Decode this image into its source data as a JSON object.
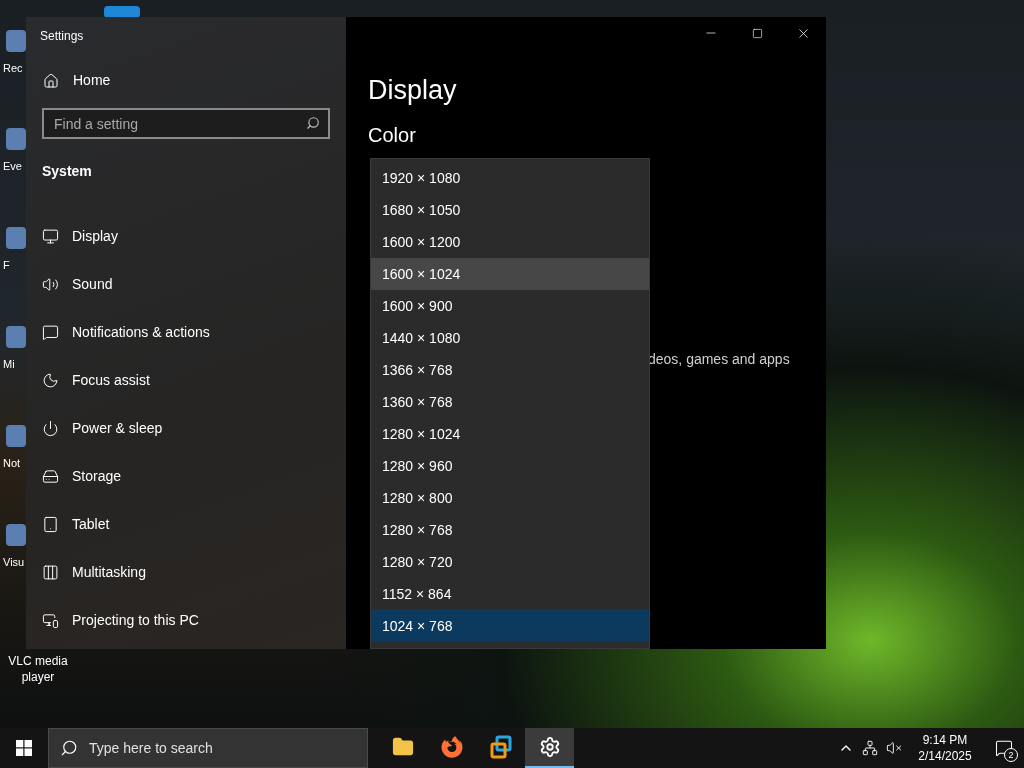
{
  "desktop": {
    "icons": [
      {
        "label": "Rec"
      },
      {
        "label": "Eve"
      },
      {
        "label": "F"
      },
      {
        "label": "Mi"
      },
      {
        "label": "Not"
      },
      {
        "label": "Visu"
      },
      {
        "label": "VLC media player"
      }
    ]
  },
  "window": {
    "title": "Settings",
    "sidebar": {
      "home": "Home",
      "search": {
        "placeholder": "Find a setting"
      },
      "section": "System",
      "items": [
        {
          "label": "Display",
          "kind": "display"
        },
        {
          "label": "Sound",
          "kind": "sound"
        },
        {
          "label": "Notifications & actions",
          "kind": "notifications"
        },
        {
          "label": "Focus assist",
          "kind": "focus"
        },
        {
          "label": "Power & sleep",
          "kind": "power"
        },
        {
          "label": "Storage",
          "kind": "storage"
        },
        {
          "label": "Tablet",
          "kind": "tablet"
        },
        {
          "label": "Multitasking",
          "kind": "multitasking"
        },
        {
          "label": "Projecting to this PC",
          "kind": "projecting"
        }
      ]
    },
    "content": {
      "heading": "Display",
      "section": "Color",
      "partial_texts": [
        "deos, games and apps"
      ],
      "dropdown": {
        "options": [
          {
            "label": "1920 × 1080",
            "selected": false,
            "hovered": false
          },
          {
            "label": "1680 × 1050",
            "selected": false,
            "hovered": false
          },
          {
            "label": "1600 × 1200",
            "selected": false,
            "hovered": false
          },
          {
            "label": "1600 × 1024",
            "selected": false,
            "hovered": true
          },
          {
            "label": "1600 × 900",
            "selected": false,
            "hovered": false
          },
          {
            "label": "1440 × 1080",
            "selected": false,
            "hovered": false
          },
          {
            "label": "1366 × 768",
            "selected": false,
            "hovered": false
          },
          {
            "label": "1360 × 768",
            "selected": false,
            "hovered": false
          },
          {
            "label": "1280 × 1024",
            "selected": false,
            "hovered": false
          },
          {
            "label": "1280 × 960",
            "selected": false,
            "hovered": false
          },
          {
            "label": "1280 × 800",
            "selected": false,
            "hovered": false
          },
          {
            "label": "1280 × 768",
            "selected": false,
            "hovered": false
          },
          {
            "label": "1280 × 720",
            "selected": false,
            "hovered": false
          },
          {
            "label": "1152 × 864",
            "selected": false,
            "hovered": false
          },
          {
            "label": "1024 × 768",
            "selected": true,
            "hovered": false
          }
        ]
      }
    }
  },
  "taskbar": {
    "search": {
      "placeholder": "Type here to search"
    },
    "apps": [
      {
        "kind": "files",
        "selected": false
      },
      {
        "kind": "browser",
        "selected": false
      },
      {
        "kind": "vm",
        "selected": false
      },
      {
        "kind": "settings",
        "selected": true
      }
    ],
    "time": "9:14 PM",
    "date": "2/14/2025",
    "notification_count": "2"
  }
}
